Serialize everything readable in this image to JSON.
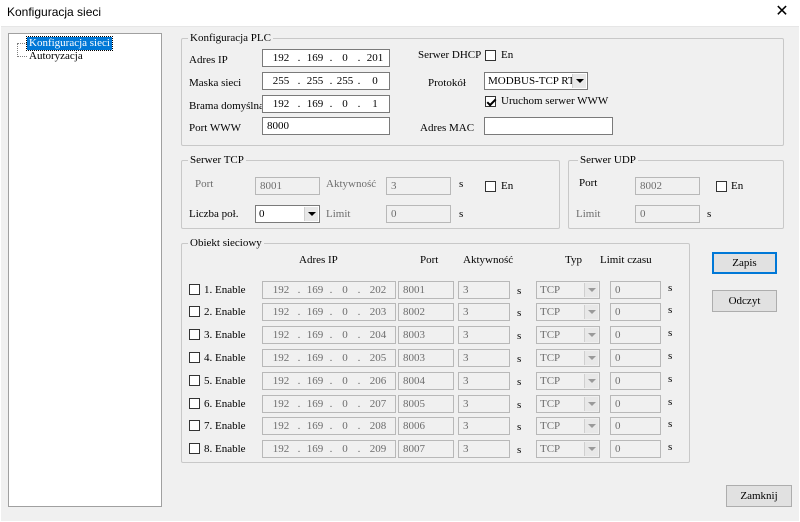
{
  "window": {
    "title": "Konfiguracja sieci"
  },
  "tree": {
    "items": [
      {
        "label": "Konfiguracja sieci",
        "selected": true
      },
      {
        "label": "Autoryzacja"
      }
    ]
  },
  "plc": {
    "group_label": "Konfiguracja PLC",
    "ip_label": "Adres IP",
    "ip": [
      "192",
      "169",
      "0",
      "201"
    ],
    "mask_label": "Maska sieci",
    "mask": [
      "255",
      "255",
      "255",
      "0"
    ],
    "gateway_label": "Brama domyślna",
    "gateway": [
      "192",
      "169",
      "0",
      "1"
    ],
    "www_port_label": "Port WWW",
    "www_port": "8000",
    "dhcp_label": "Serwer DHCP",
    "dhcp_en_label": "En",
    "dhcp_enabled": false,
    "protocol_label": "Protokół",
    "protocol": "MODBUS-TCP RTU",
    "www_server_label": "Uruchom serwer WWW",
    "www_server_enabled": true,
    "mac_label": "Adres MAC",
    "mac": ""
  },
  "tcp": {
    "group_label": "Serwer TCP",
    "port_label": "Port",
    "port": "8001",
    "activity_label": "Aktywność",
    "activity": "3",
    "activity_unit": "s",
    "en_label": "En",
    "enabled": false,
    "count_label": "Liczba poł.",
    "count": "0",
    "limit_label": "Limit",
    "limit": "0",
    "limit_unit": "s"
  },
  "udp": {
    "group_label": "Serwer UDP",
    "port_label": "Port",
    "port": "8002",
    "en_label": "En",
    "enabled": false,
    "limit_label": "Limit",
    "limit": "0",
    "limit_unit": "s"
  },
  "objects": {
    "group_label": "Obiekt sieciowy",
    "headers": {
      "ip": "Adres IP",
      "port": "Port",
      "activity": "Aktywność",
      "type": "Typ",
      "timeout": "Limit czasu"
    },
    "rows": [
      {
        "label": "1. Enable",
        "ip": [
          "192",
          "169",
          "0",
          "202"
        ],
        "port": "8001",
        "activity": "3",
        "unit1": "s",
        "type": "TCP",
        "timeout": "0",
        "unit2": "s"
      },
      {
        "label": "2. Enable",
        "ip": [
          "192",
          "169",
          "0",
          "203"
        ],
        "port": "8002",
        "activity": "3",
        "unit1": "s",
        "type": "TCP",
        "timeout": "0",
        "unit2": "s"
      },
      {
        "label": "3. Enable",
        "ip": [
          "192",
          "169",
          "0",
          "204"
        ],
        "port": "8003",
        "activity": "3",
        "unit1": "s",
        "type": "TCP",
        "timeout": "0",
        "unit2": "s"
      },
      {
        "label": "4. Enable",
        "ip": [
          "192",
          "169",
          "0",
          "205"
        ],
        "port": "8003",
        "activity": "3",
        "unit1": "s",
        "type": "TCP",
        "timeout": "0",
        "unit2": "s"
      },
      {
        "label": "5. Enable",
        "ip": [
          "192",
          "169",
          "0",
          "206"
        ],
        "port": "8004",
        "activity": "3",
        "unit1": "s",
        "type": "TCP",
        "timeout": "0",
        "unit2": "s"
      },
      {
        "label": "6. Enable",
        "ip": [
          "192",
          "169",
          "0",
          "207"
        ],
        "port": "8005",
        "activity": "3",
        "unit1": "s",
        "type": "TCP",
        "timeout": "0",
        "unit2": "s"
      },
      {
        "label": "7. Enable",
        "ip": [
          "192",
          "169",
          "0",
          "208"
        ],
        "port": "8006",
        "activity": "3",
        "unit1": "s",
        "type": "TCP",
        "timeout": "0",
        "unit2": "s"
      },
      {
        "label": "8. Enable",
        "ip": [
          "192",
          "169",
          "0",
          "209"
        ],
        "port": "8007",
        "activity": "3",
        "unit1": "s",
        "type": "TCP",
        "timeout": "0",
        "unit2": "s"
      }
    ]
  },
  "buttons": {
    "save": "Zapis",
    "read": "Odczyt",
    "close": "Zamknij"
  },
  "colors": {
    "selection": "#0078d7",
    "dialog_bg": "#f0f0f0",
    "disabled_text": "#6d6d6d"
  }
}
